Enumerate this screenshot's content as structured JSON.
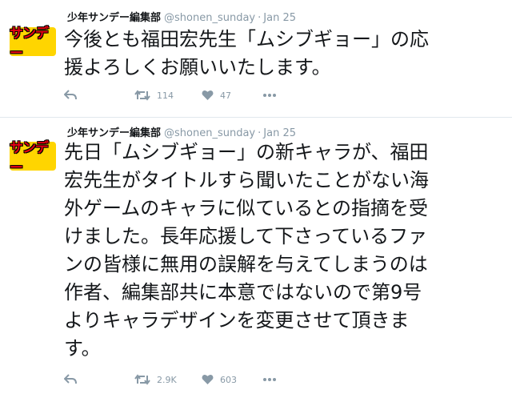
{
  "tweets": [
    {
      "avatar_text": "サンデー",
      "name": "少年サンデー編集部",
      "handle": "@shonen_sunday",
      "dot": "·",
      "date": "Jan 25",
      "text": "今後とも福田宏先生「ムシブギョー」の応\n援よろしくお願いいたします。",
      "retweets": "114",
      "likes": "47"
    },
    {
      "avatar_text": "サンデー",
      "name": "少年サンデー編集部",
      "handle": "@shonen_sunday",
      "dot": "·",
      "date": "Jan 25",
      "text": "先日「ムシブギョー」の新キャラが、福田\n宏先生がタイトルすら聞いたことがない海\n外ゲームのキャラに似ているとの指摘を受\nけました。長年応援して下さっているファ\nンの皆様に無用の誤解を与えてしまうのは\n作者、編集部共に本意ではないので第9号\nよりキャラデザインを変更させて頂きま\nす。",
      "retweets": "2.9K",
      "likes": "603"
    }
  ],
  "icons": {
    "reply": "reply-icon",
    "retweet": "retweet-icon",
    "like": "heart-icon",
    "more": "more-icon"
  },
  "colors": {
    "text": "#14171a",
    "muted": "#8899a6",
    "divider": "#e1e8ed",
    "avatar_bg": "#ffd500",
    "avatar_text": "#e60012"
  }
}
